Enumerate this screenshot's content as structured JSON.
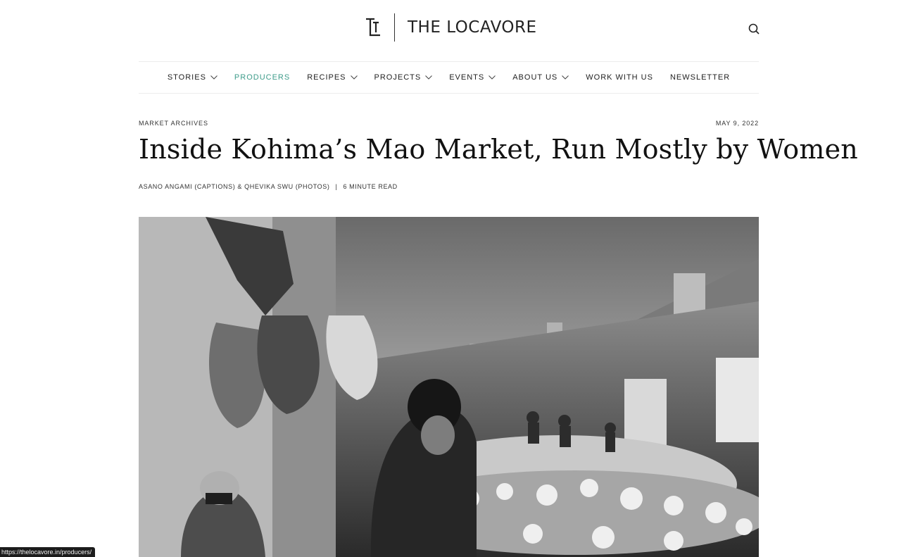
{
  "brand": {
    "name": "THE LOCAVORE"
  },
  "header": {
    "search_icon": "search-icon"
  },
  "nav": {
    "items": [
      {
        "label": "STORIES",
        "dropdown": true,
        "active": false
      },
      {
        "label": "PRODUCERS",
        "dropdown": false,
        "active": true
      },
      {
        "label": "RECIPES",
        "dropdown": true,
        "active": false
      },
      {
        "label": "PROJECTS",
        "dropdown": true,
        "active": false
      },
      {
        "label": "EVENTS",
        "dropdown": true,
        "active": false
      },
      {
        "label": "ABOUT US",
        "dropdown": true,
        "active": false
      },
      {
        "label": "WORK WITH US",
        "dropdown": false,
        "active": false
      },
      {
        "label": "NEWSLETTER",
        "dropdown": false,
        "active": false
      }
    ],
    "active_color": "#3e9c8a"
  },
  "article": {
    "category": "MARKET ARCHIVES",
    "date": "MAY 9, 2022",
    "title": "Inside Kohima’s Mao Market, Run Mostly by Women",
    "authors": "ASANO ANGAMI (CAPTIONS) & QHEVIKA SWU (PHOTOS)",
    "separator": "|",
    "read_time": "6 MINUTE READ"
  },
  "status_bar": {
    "url": "https://thelocavore.in/producers/"
  }
}
